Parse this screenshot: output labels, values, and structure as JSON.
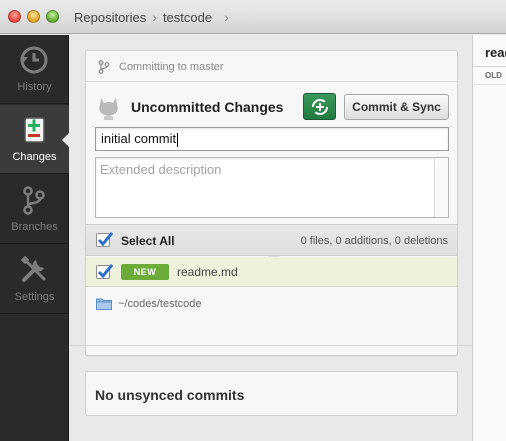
{
  "breadcrumbs": [
    "Repositories",
    "testcode"
  ],
  "sidebar": {
    "items": [
      {
        "label": "History",
        "icon": "history-icon",
        "active": false
      },
      {
        "label": "Changes",
        "icon": "changes-icon",
        "active": true
      },
      {
        "label": "Branches",
        "icon": "branch-icon",
        "active": false
      },
      {
        "label": "Settings",
        "icon": "settings-icon",
        "active": false
      }
    ]
  },
  "commit_panel": {
    "branch_status": "Committing to master",
    "title": "Uncommitted Changes",
    "commit_button": "Commit & Sync",
    "summary_value": "initial commit",
    "description_placeholder": "Extended description",
    "select_all_label": "Select All",
    "stats": "0 files, 0 additions, 0 deletions",
    "files": [
      {
        "status": "NEW",
        "name": "readme.md",
        "checked": true
      }
    ],
    "repo_path": "~/codes/testcode"
  },
  "unsynced": {
    "label": "No unsynced commits"
  },
  "diff": {
    "file_name": "readme.md",
    "column_label": "OLD"
  },
  "colors": {
    "sidebar_bg": "#2a2a2a",
    "sync_button": "#2e8a4b",
    "new_badge": "#6cab38",
    "file_row_bg": "#eef2dc",
    "checkbox_blue": "#2b6fc9"
  }
}
